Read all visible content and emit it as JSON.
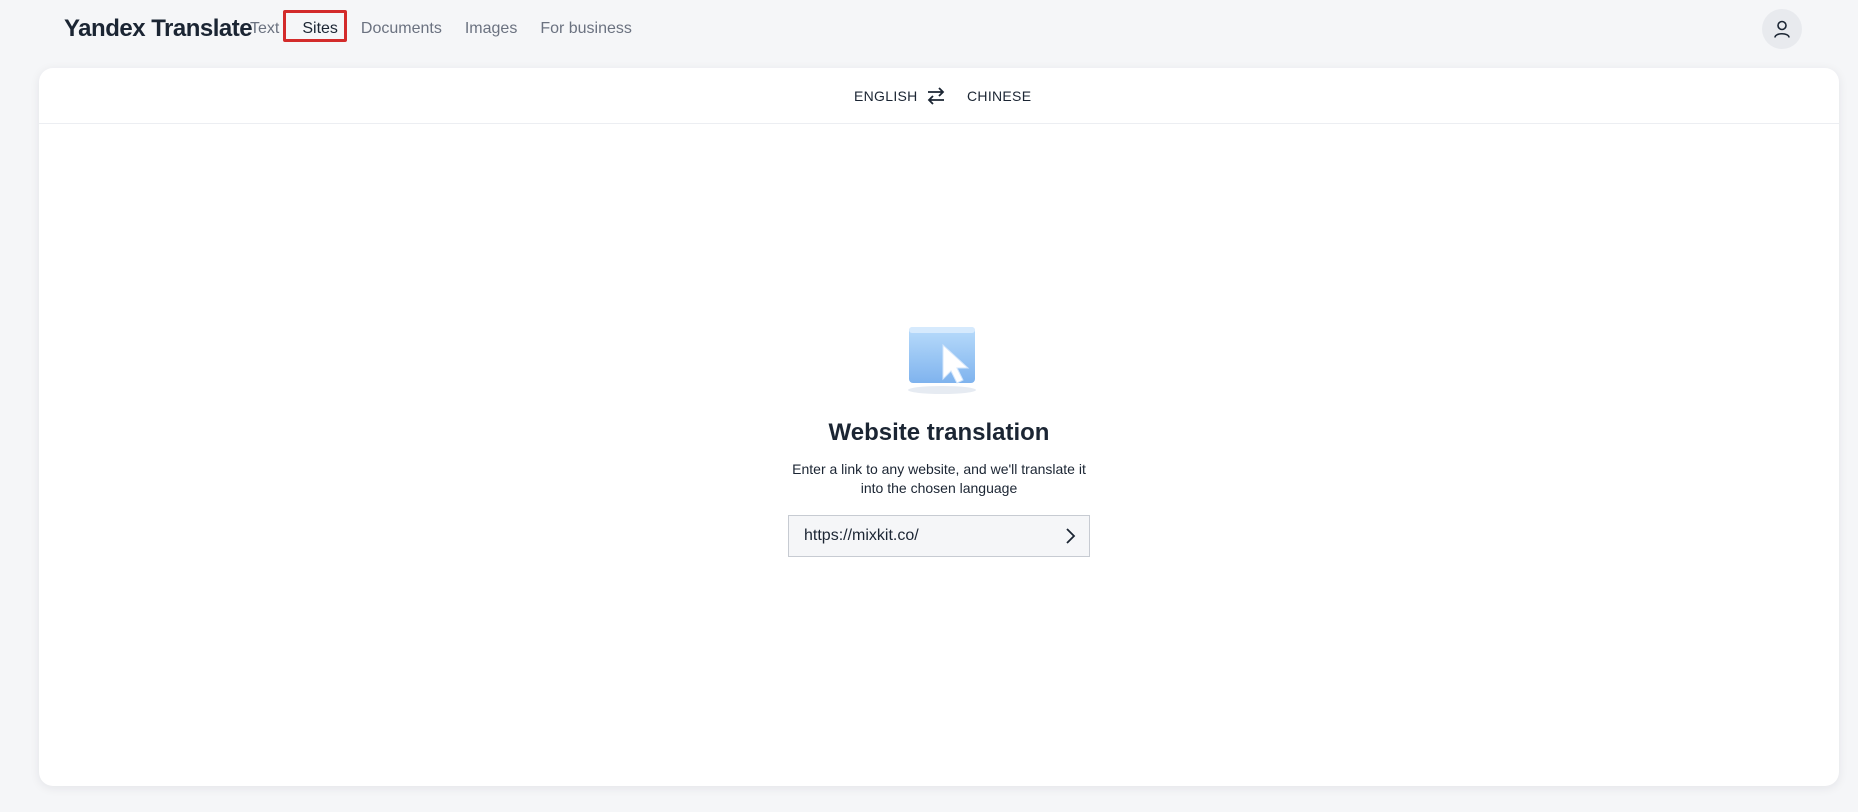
{
  "app": {
    "logo": "Yandex Translate"
  },
  "nav": {
    "items": [
      {
        "label": "Text",
        "active": false
      },
      {
        "label": "Sites",
        "active": true
      },
      {
        "label": "Documents",
        "active": false
      },
      {
        "label": "Images",
        "active": false
      },
      {
        "label": "For business",
        "active": false
      }
    ]
  },
  "header": {
    "avatar_icon": "user-icon"
  },
  "languages": {
    "source": "ENGLISH",
    "target": "CHINESE",
    "swap_icon": "swap-arrows-icon"
  },
  "main": {
    "illustration_icon": "folder-cursor-icon",
    "title": "Website translation",
    "subtitle": "Enter a link to any website, and we'll translate it into the chosen language",
    "url_value": "https://mixkit.co/",
    "submit_icon": "chevron-right-icon"
  },
  "colors": {
    "background": "#f5f6f8",
    "card": "#ffffff",
    "text": "#1b2533",
    "muted": "#6b7280",
    "highlight": "#d32b2b"
  }
}
